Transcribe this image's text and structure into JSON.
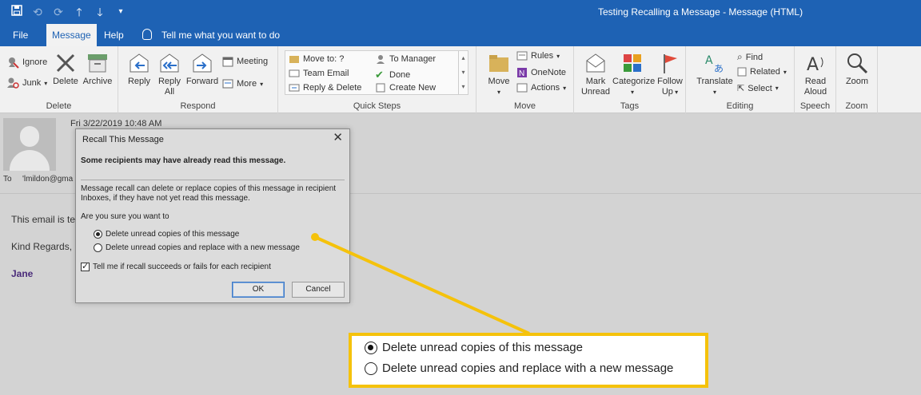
{
  "window": {
    "title": "Testing Recalling a Message  -  Message (HTML)"
  },
  "qat": {
    "icons": [
      "save-icon",
      "undo-icon",
      "redo-icon",
      "up-arrow-icon",
      "down-arrow-icon",
      "customize-icon"
    ]
  },
  "tabs": {
    "file": "File",
    "message": "Message",
    "help": "Help",
    "tell_me": "Tell me what you want to do"
  },
  "ribbon": {
    "delete_group": {
      "label": "Delete",
      "ignore": "Ignore",
      "junk": "Junk",
      "delete": "Delete",
      "archive": "Archive"
    },
    "respond_group": {
      "label": "Respond",
      "reply": "Reply",
      "reply_all_1": "Reply",
      "reply_all_2": "All",
      "forward": "Forward",
      "meeting": "Meeting",
      "more": "More"
    },
    "quick_steps": {
      "label": "Quick Steps",
      "items": [
        "Move to: ?",
        "Team Email",
        "Reply & Delete",
        "To Manager",
        "Done",
        "Create New"
      ]
    },
    "move_group": {
      "label": "Move",
      "move": "Move",
      "rules": "Rules",
      "onenote": "OneNote",
      "actions": "Actions"
    },
    "tags_group": {
      "label": "Tags",
      "mark_unread_1": "Mark",
      "mark_unread_2": "Unread",
      "categorize": "Categorize",
      "follow_up_1": "Follow",
      "follow_up_2": "Up"
    },
    "editing_group": {
      "label": "Editing",
      "translate": "Translate",
      "find": "Find",
      "related": "Related",
      "select": "Select"
    },
    "speech_group": {
      "label": "Speech",
      "read_aloud_1": "Read",
      "read_aloud_2": "Aloud"
    },
    "zoom_group": {
      "label": "Zoom",
      "zoom": "Zoom"
    }
  },
  "message": {
    "date": "Fri 3/22/2019 10:48 AM",
    "to_label": "To",
    "to_value": "'lmildon@gma",
    "body_line": "This email is te",
    "regards": "Kind Regards,",
    "signature": "Jane"
  },
  "dialog": {
    "title": "Recall This Message",
    "close": "✕",
    "warning": "Some recipients may have already read this message.",
    "explanation": "Message recall can delete or replace copies of this message in recipient Inboxes, if they have not yet read this message.",
    "question": "Are you sure you want to",
    "option_delete": "Delete unread copies of this message",
    "option_replace": "Delete unread copies and replace with a new message",
    "selected_option": "option_delete",
    "notify_label": "Tell me if recall succeeds or fails for each recipient",
    "notify_checked": true,
    "ok": "OK",
    "cancel": "Cancel"
  },
  "callout": {
    "option_delete": "Delete unread copies of this message",
    "option_replace": "Delete unread copies and replace with a new message",
    "border_color": "#f5c20b"
  },
  "colors": {
    "accent": "#1e62b4",
    "highlight": "#f5c20b"
  }
}
